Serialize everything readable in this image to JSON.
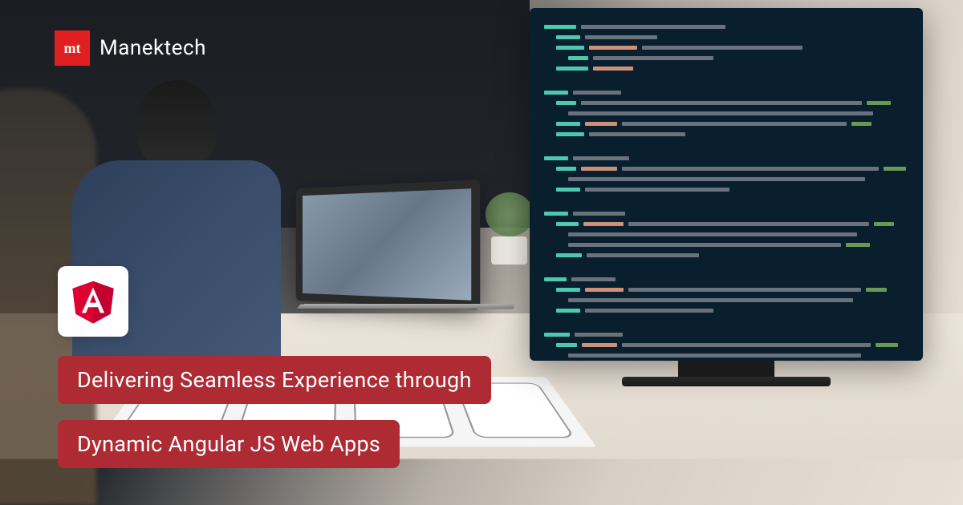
{
  "brand": {
    "logo_mark": "mt",
    "logo_text": "Manektech"
  },
  "framework_icon": "angular",
  "headline": {
    "line1": "Delivering Seamless Experience through",
    "line2": "Dynamic Angular JS Web Apps"
  },
  "colors": {
    "brand_red": "#ae2b33",
    "logo_red": "#e02020",
    "angular_red": "#dd0031",
    "angular_dark": "#c3002f"
  }
}
